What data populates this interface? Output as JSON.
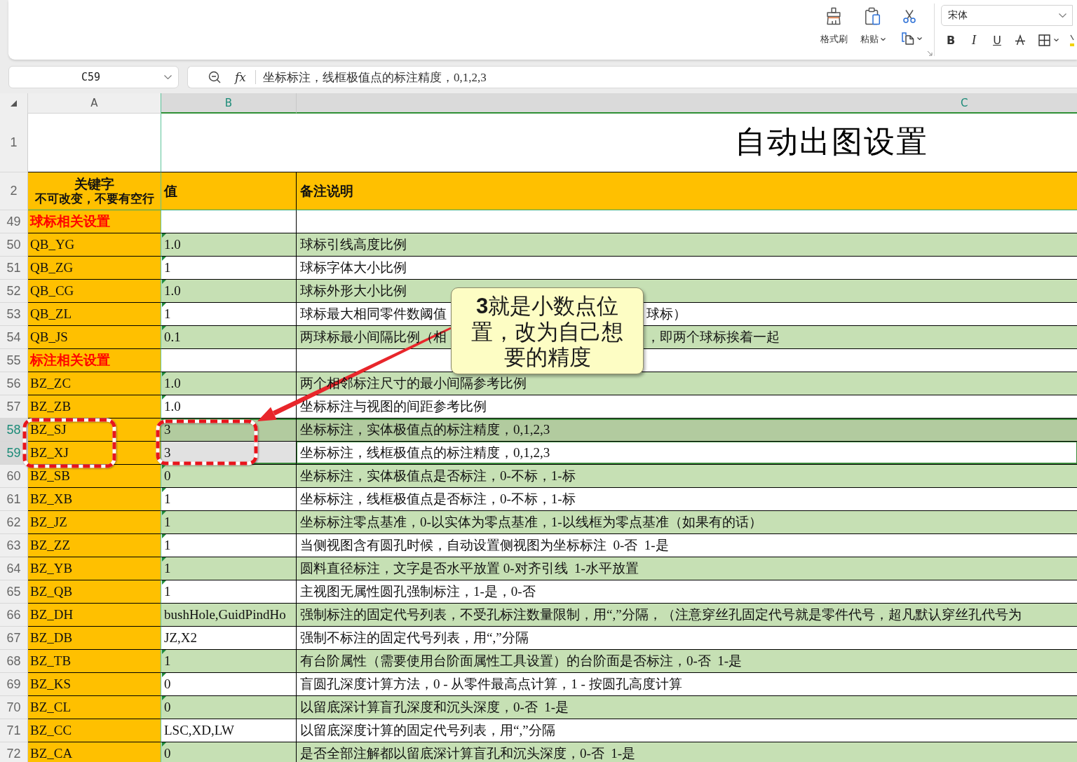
{
  "ribbon": {
    "clipboard": {
      "format_painter": {
        "label": "格式刷"
      },
      "paste": {
        "label": "粘贴"
      }
    },
    "font_name": "宋体",
    "format_buttons": [
      {
        "kind": "bold",
        "label": "B"
      },
      {
        "kind": "italic",
        "label": "I"
      },
      {
        "kind": "underline",
        "label": "U"
      },
      {
        "kind": "strikethrough"
      },
      {
        "kind": "borders"
      },
      {
        "kind": "highlight"
      }
    ]
  },
  "formula_bar": {
    "name_box": "C59",
    "function_label": "fx",
    "formula": "坐标标注，线框极值点的标注精度，0,1,2,3"
  },
  "sheet": {
    "columns": [
      {
        "label": "A",
        "selected": false
      },
      {
        "label": "B",
        "selected": true
      },
      {
        "label": "C",
        "selected": true
      }
    ],
    "title_row": {
      "row": "1",
      "title": "自动出图设置"
    },
    "header_row": {
      "row": "2",
      "key_title": "关键字",
      "key_note": "不可改变，不要有空行",
      "value": "值",
      "note": "备注说明"
    },
    "rows": [
      {
        "row": "49",
        "kind": "section",
        "key": "球标相关设置",
        "shaded": false,
        "corner_mark": false,
        "selected": false,
        "active": false
      },
      {
        "row": "50",
        "kind": "setting",
        "key": "QB_YG",
        "value": "1.0",
        "note": "球标引线高度比例",
        "shaded": true,
        "corner_mark": true,
        "selected": false,
        "active": false
      },
      {
        "row": "51",
        "kind": "setting",
        "key": "QB_ZG",
        "value": "1",
        "note": "球标字体大小比例",
        "shaded": false,
        "corner_mark": true,
        "selected": false,
        "active": false
      },
      {
        "row": "52",
        "kind": "setting",
        "key": "QB_CG",
        "value": "1.0",
        "note": "球标外形大小比例",
        "shaded": true,
        "corner_mark": true,
        "selected": false,
        "active": false
      },
      {
        "row": "53",
        "kind": "setting",
        "key": "QB_ZL",
        "value": "1",
        "note": "球标最大相同零件数阈值",
        "note_right": "球标）",
        "shaded": false,
        "corner_mark": true,
        "selected": false,
        "active": false
      },
      {
        "row": "54",
        "kind": "setting",
        "key": "QB_JS",
        "value": "0.1",
        "note": "两球标最小间隔比例（相",
        "note_right": "，即两个球标挨着一起",
        "shaded": true,
        "corner_mark": true,
        "selected": false,
        "active": false
      },
      {
        "row": "55",
        "kind": "section",
        "key": "标注相关设置",
        "shaded": false,
        "corner_mark": false,
        "selected": false,
        "active": false
      },
      {
        "row": "56",
        "kind": "setting",
        "key": "BZ_ZC",
        "value": "1.0",
        "note": "两个相邻标注尺寸的最小间隔参考比例",
        "shaded": true,
        "corner_mark": true,
        "selected": false,
        "active": false
      },
      {
        "row": "57",
        "kind": "setting",
        "key": "BZ_ZB",
        "value": "1.0",
        "note": "坐标标注与视图的间距参考比例",
        "shaded": false,
        "corner_mark": true,
        "selected": false,
        "active": false
      },
      {
        "row": "58",
        "kind": "setting",
        "key": "BZ_SJ",
        "value": "3",
        "note": "坐标标注，实体极值点的标注精度，0,1,2,3",
        "shaded": true,
        "corner_mark": false,
        "selected": true,
        "active": false
      },
      {
        "row": "59",
        "kind": "setting",
        "key": "BZ_XJ",
        "value": "3",
        "note": "坐标标注，线框极值点的标注精度，0,1,2,3",
        "shaded": false,
        "corner_mark": false,
        "selected": true,
        "active": true
      },
      {
        "row": "60",
        "kind": "setting",
        "key": "BZ_SB",
        "value": "0",
        "note": "坐标标注，实体极值点是否标注，0-不标，1-标",
        "shaded": true,
        "corner_mark": true,
        "selected": false,
        "active": false
      },
      {
        "row": "61",
        "kind": "setting",
        "key": "BZ_XB",
        "value": "1",
        "note": "坐标标注，线框极值点是否标注，0-不标，1-标",
        "shaded": false,
        "corner_mark": true,
        "selected": false,
        "active": false
      },
      {
        "row": "62",
        "kind": "setting",
        "key": "BZ_JZ",
        "value": "1",
        "note": "坐标标注零点基准，0-以实体为零点基准，1-以线框为零点基准（如果有的话）",
        "shaded": true,
        "corner_mark": true,
        "selected": false,
        "active": false
      },
      {
        "row": "63",
        "kind": "setting",
        "key": "BZ_ZZ",
        "value": "1",
        "note": "当侧视图含有圆孔时候，自动设置侧视图为坐标标注  0-否  1-是",
        "shaded": false,
        "corner_mark": true,
        "selected": false,
        "active": false
      },
      {
        "row": "64",
        "kind": "setting",
        "key": "BZ_YB",
        "value": "1",
        "note": "圆料直径标注，文字是否水平放置 0-对齐引线  1-水平放置",
        "shaded": true,
        "corner_mark": true,
        "selected": false,
        "active": false
      },
      {
        "row": "65",
        "kind": "setting",
        "key": "BZ_QB",
        "value": "1",
        "note": "主视图无属性圆孔强制标注，1-是，0-否",
        "shaded": false,
        "corner_mark": true,
        "selected": false,
        "active": false
      },
      {
        "row": "66",
        "kind": "setting",
        "key": "BZ_DH",
        "value": "bushHole,GuidPindHo",
        "note": "强制标注的固定代号列表，不受孔标注数量限制，用“,”分隔，（注意穿丝孔固定代号就是零件代号，超凡默认穿丝孔代号为",
        "shaded": true,
        "corner_mark": false,
        "selected": false,
        "active": false
      },
      {
        "row": "67",
        "kind": "setting",
        "key": "BZ_DB",
        "value": "JZ,X2",
        "note": "强制不标注的固定代号列表，用“,”分隔",
        "shaded": false,
        "corner_mark": false,
        "selected": false,
        "active": false
      },
      {
        "row": "68",
        "kind": "setting",
        "key": "BZ_TB",
        "value": "1",
        "note": "有台阶属性（需要使用台阶面属性工具设置）的台阶面是否标注，0-否  1-是",
        "shaded": true,
        "corner_mark": true,
        "selected": false,
        "active": false
      },
      {
        "row": "69",
        "kind": "setting",
        "key": "BZ_KS",
        "value": "0",
        "note": "盲圆孔深度计算方法，0 - 从零件最高点计算，1 - 按圆孔高度计算",
        "shaded": false,
        "corner_mark": true,
        "selected": false,
        "active": false
      },
      {
        "row": "70",
        "kind": "setting",
        "key": "BZ_CL",
        "value": "0",
        "note": "以留底深计算盲孔深度和沉头深度，0-否  1-是",
        "shaded": true,
        "corner_mark": true,
        "selected": false,
        "active": false
      },
      {
        "row": "71",
        "kind": "setting",
        "key": "BZ_CC",
        "value": "LSC,XD,LW",
        "note": "以留底深度计算的固定代号列表，用“,”分隔",
        "shaded": false,
        "corner_mark": false,
        "selected": false,
        "active": false
      },
      {
        "row": "72",
        "kind": "setting",
        "key": "BZ_CA",
        "value": "0",
        "note": "是否全部注解都以留底深计算盲孔和沉头深度，0-否  1-是",
        "shaded": true,
        "corner_mark": true,
        "selected": false,
        "active": false
      }
    ]
  },
  "callout": {
    "text": "**3**就是小数点位置，改为自己想要的精度"
  }
}
